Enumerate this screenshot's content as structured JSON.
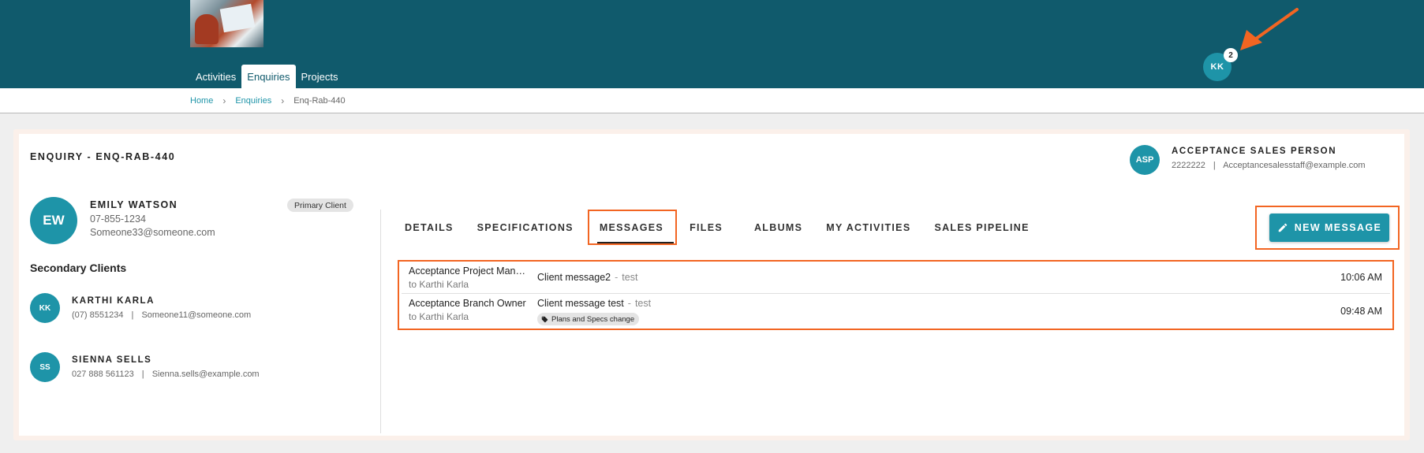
{
  "colors": {
    "header_bg": "#105a6c",
    "accent": "#1e94a8",
    "annotation": "#f26522"
  },
  "header": {
    "nav": [
      {
        "label": "Activities",
        "active": false
      },
      {
        "label": "Enquiries",
        "active": true
      },
      {
        "label": "Projects",
        "active": false
      }
    ],
    "user_initials": "KK",
    "notification_count": "2"
  },
  "breadcrumb": {
    "home": "Home",
    "section": "Enquiries",
    "current": "Enq-Rab-440",
    "separator": "›"
  },
  "enquiry": {
    "title": "ENQUIRY - ENQ-RAB-440"
  },
  "sales_person": {
    "initials": "ASP",
    "name": "ACCEPTANCE SALES PERSON",
    "phone": "2222222",
    "separator": "|",
    "email": "Acceptancesalesstaff@example.com"
  },
  "primary_client": {
    "initials": "EW",
    "name": "EMILY WATSON",
    "phone": "07-855-1234",
    "email": "Someone33@someone.com",
    "chip": "Primary Client"
  },
  "secondary": {
    "heading": "Secondary Clients",
    "clients": [
      {
        "initials": "KK",
        "name": "KARTHI KARLA",
        "phone": "(07) 8551234",
        "separator": "|",
        "email": "Someone11@someone.com"
      },
      {
        "initials": "SS",
        "name": "SIENNA SELLS",
        "phone": "027 888 561123",
        "separator": "|",
        "email": "Sienna.sells@example.com"
      }
    ]
  },
  "tabs": [
    {
      "label": "DETAILS",
      "active": false
    },
    {
      "label": "SPECIFICATIONS",
      "active": false
    },
    {
      "label": "MESSAGES",
      "active": true
    },
    {
      "label": "FILES",
      "active": false
    },
    {
      "label": "ALBUMS",
      "active": false
    },
    {
      "label": "MY ACTIVITIES",
      "active": false
    },
    {
      "label": "SALES PIPELINE",
      "active": false
    }
  ],
  "new_message": {
    "label": "NEW MESSAGE",
    "icon": "pencil-icon"
  },
  "messages": [
    {
      "from": "Acceptance Project Manager",
      "to": "to Karthi Karla",
      "subject": "Client message2",
      "separator": "-",
      "preview": "test",
      "time": "10:06 AM"
    },
    {
      "from": "Acceptance Branch Owner",
      "to": "to Karthi Karla",
      "subject": "Client message test",
      "separator": "-",
      "preview": "test",
      "tag": "Plans and Specs change",
      "tag_icon": "tag-icon",
      "time": "09:48 AM"
    }
  ]
}
